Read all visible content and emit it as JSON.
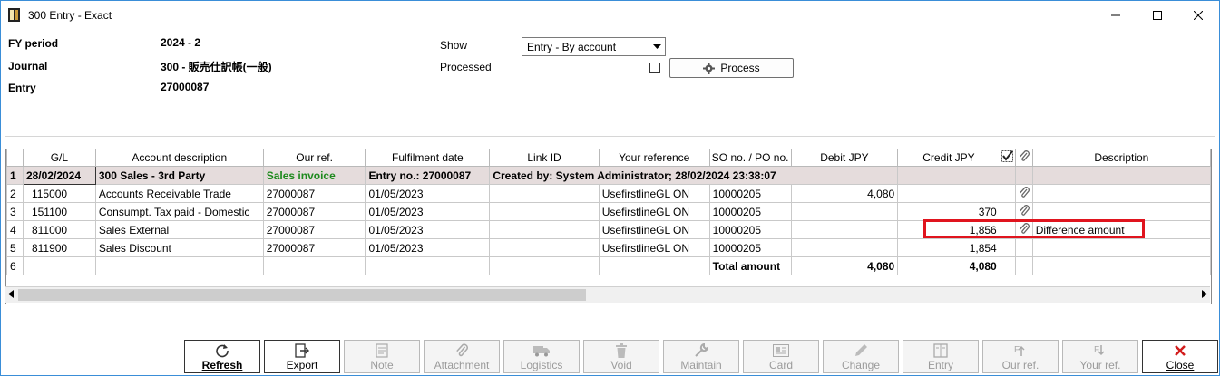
{
  "window": {
    "title": "300 Entry - Exact",
    "controls": [
      "minimize-icon",
      "maximize-icon",
      "close-icon"
    ]
  },
  "header": {
    "fy_label": "FY period",
    "fy_value": "2024 - 2",
    "journal_label": "Journal",
    "journal_value": "300 - 販売仕訳帳(一般)",
    "entry_label": "Entry",
    "entry_value": "27000087",
    "show_label": "Show",
    "show_value": "Entry - By account",
    "processed_label": "Processed",
    "processed_checked": false,
    "process_button": "Process"
  },
  "grid": {
    "columns": [
      "",
      "G/L",
      "Account description",
      "Our ref.",
      "Fulfilment date",
      "Link ID",
      "Your reference",
      "SO no. / PO no.",
      "Debit JPY",
      "Credit JPY",
      "",
      "",
      "Description"
    ],
    "header_row": {
      "num": "1",
      "gl": "28/02/2024",
      "desc": "300 Sales - 3rd Party",
      "ourref": "Sales invoice",
      "fulfil": "Entry no.: 27000087",
      "linkid": "Created by: System Administrator; 28/02/2024 23:38:07"
    },
    "rows": [
      {
        "num": "2",
        "gl": "115000",
        "desc": "Accounts Receivable Trade",
        "ourref": "27000087",
        "fulfil": "01/05/2023",
        "linkid": "",
        "yourref": "UsefirstlineGL ON",
        "so": "10000205",
        "debit": "4,080",
        "credit": "",
        "attach": true,
        "description": ""
      },
      {
        "num": "3",
        "gl": "151100",
        "desc": "Consumpt. Tax paid - Domestic",
        "ourref": "27000087",
        "fulfil": "01/05/2023",
        "linkid": "",
        "yourref": "UsefirstlineGL ON",
        "so": "10000205",
        "debit": "",
        "credit": "370",
        "attach": true,
        "description": ""
      },
      {
        "num": "4",
        "gl": "811000",
        "desc": "Sales External",
        "ourref": "27000087",
        "fulfil": "01/05/2023",
        "linkid": "",
        "yourref": "UsefirstlineGL ON",
        "so": "10000205",
        "debit": "",
        "credit": "1,856",
        "attach": true,
        "description": "Difference amount"
      },
      {
        "num": "5",
        "gl": "811900",
        "desc": "Sales Discount",
        "ourref": "27000087",
        "fulfil": "01/05/2023",
        "linkid": "",
        "yourref": "UsefirstlineGL ON",
        "so": "10000205",
        "debit": "",
        "credit": "1,854",
        "attach": false,
        "description": ""
      }
    ],
    "total_row": {
      "num": "6",
      "label": "Total amount",
      "debit": "4,080",
      "credit": "4,080"
    }
  },
  "toolbar": [
    {
      "label": "Refresh",
      "icon": "refresh-icon",
      "enabled": true,
      "bold": true
    },
    {
      "label": "Export",
      "icon": "export-icon",
      "enabled": true,
      "bold": false
    },
    {
      "label": "Note",
      "icon": "note-icon",
      "enabled": false
    },
    {
      "label": "Attachment",
      "icon": "paperclip-icon",
      "enabled": false
    },
    {
      "label": "Logistics",
      "icon": "truck-icon",
      "enabled": false
    },
    {
      "label": "Void",
      "icon": "trash-icon",
      "enabled": false
    },
    {
      "label": "Maintain",
      "icon": "wrench-icon",
      "enabled": false
    },
    {
      "label": "Card",
      "icon": "card-icon",
      "enabled": false
    },
    {
      "label": "Change",
      "icon": "pencil-icon",
      "enabled": false
    },
    {
      "label": "Entry",
      "icon": "book-icon",
      "enabled": false
    },
    {
      "label": "Our ref.",
      "icon": "our-ref-icon",
      "enabled": false
    },
    {
      "label": "Your ref.",
      "icon": "your-ref-icon",
      "enabled": false
    },
    {
      "label": "Close",
      "icon": "close-x-icon",
      "enabled": true,
      "bold": false
    }
  ],
  "colors": {
    "accent_red": "#e0141e",
    "green_text": "#1e8a1e",
    "row1_bg": "#e5dcdc"
  }
}
